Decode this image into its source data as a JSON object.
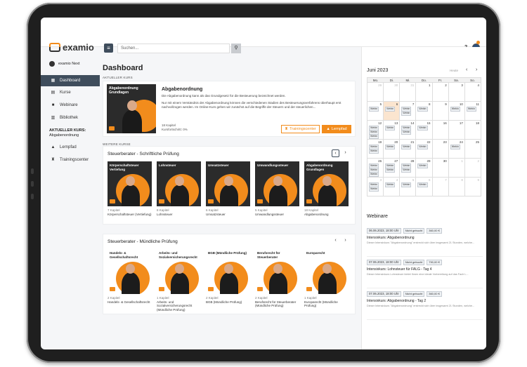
{
  "app": {
    "logo_text": "examio",
    "search_placeholder": "Suchen...",
    "help": "?"
  },
  "sidebar": {
    "user": "examio Next",
    "items": [
      {
        "label": "Dashboard",
        "icon": "dashboard-icon",
        "active": true
      },
      {
        "label": "Kurse",
        "icon": "courses-icon"
      },
      {
        "label": "Webinare",
        "icon": "webinar-icon"
      },
      {
        "label": "Bibliothek",
        "icon": "library-icon"
      }
    ],
    "current_course_label": "AKTUELLER KURS:",
    "current_course": "Abgabenordnung",
    "sub_items": [
      {
        "label": "Lernpfad",
        "icon": "graduation-cap-icon"
      },
      {
        "label": "Trainingscenter",
        "icon": "trophy-icon"
      }
    ]
  },
  "main": {
    "title": "Dashboard",
    "current_label": "AKTUELLER KURS",
    "hero": {
      "image_title": "Abgabenordnung Grundlagen",
      "title": "Abgabenordnung",
      "text1": "Die Abgabenordnung kann als das Grundgesetz für die Besteuerung bezeichnet werden.",
      "text2": "Nur mit einem Verständnis der Abgabenordnung können die verschiedenen Stadien des Besteuerungsverfahrens überhaupt erst nachvollzogen werden. Im Online-Kurs gehen wir zunächst auf die Begriffe der Steuern und der steuerlichen...",
      "chapters": "18 Kapitel",
      "progress": "Kursfortschritt: 0%",
      "btn_training": "Trainingscenter",
      "btn_path": "Lernpfad"
    },
    "more_label": "WEITERE KURSE",
    "row1": {
      "title": "Steuerberater - Schriftliche Prüfung",
      "tiles": [
        {
          "img": "Körperschaftsteuer Vertiefung",
          "chapters": "7 Kapitel",
          "name": "Körperschaftsteuer (Vertiefung)"
        },
        {
          "img": "Lohnsteuer",
          "chapters": "8 Kapitel",
          "name": "Lohnsteuer"
        },
        {
          "img": "Umsatzsteuer",
          "chapters": "6 Kapitel",
          "name": "Umsatzsteuer"
        },
        {
          "img": "Umwandlungssteuer",
          "chapters": "5 Kapitel",
          "name": "Umwandlungssteuer"
        },
        {
          "img": "Abgabenordnung Grundlagen",
          "chapters": "18 Kapitel",
          "name": "Abgabenordnung"
        }
      ]
    },
    "row2": {
      "title": "Steuerberater - Mündliche Prüfung",
      "tiles": [
        {
          "img": "Handels- & Gesellschaftsrecht",
          "chapters": "2 Kapitel",
          "name": "Handels- & Gesellschaftsrecht"
        },
        {
          "img": "Arbeits- und Sozialversicherungsrecht",
          "chapters": "1 Kapitel",
          "name": "Arbeits- und Sozialversicherungsrecht (Mündliche Prüfung)"
        },
        {
          "img": "BGB (Mündliche Prüfung)",
          "chapters": "2 Kapitel",
          "name": "BGB (Mündliche Prüfung)"
        },
        {
          "img": "Berufsrecht für Steuerberater",
          "chapters": "2 Kapitel",
          "name": "Berufsrecht für Steuerberater (Mündliche Prüfung)"
        },
        {
          "img": "Europarecht",
          "chapters": "1 Kapitel",
          "name": "Europarecht (Mündliche Prüfung)"
        }
      ]
    }
  },
  "calendar": {
    "title": "Juni 2023",
    "today": "Heute",
    "days": [
      "Mo.",
      "Di.",
      "Mi.",
      "Do.",
      "Fr.",
      "Sa.",
      "So."
    ],
    "weeks": [
      [
        {
          "n": "29",
          "o": 1
        },
        {
          "n": "30",
          "o": 1
        },
        {
          "n": "31",
          "o": 1
        },
        {
          "n": "1"
        },
        {
          "n": "2"
        },
        {
          "n": "3"
        },
        {
          "n": "4"
        }
      ],
      [
        {
          "n": "5",
          "e": [
            "Webin"
          ]
        },
        {
          "n": "6",
          "t": 1,
          "e": [
            "Webin"
          ]
        },
        {
          "n": "7",
          "e": [
            "Webin",
            "Webin"
          ]
        },
        {
          "n": "8",
          "e": [
            "Webin"
          ]
        },
        {
          "n": "9"
        },
        {
          "n": "10",
          "e": [
            "Webin"
          ]
        },
        {
          "n": "11",
          "e": [
            "Webin"
          ]
        }
      ],
      [
        {
          "n": "12",
          "e": [
            "Webin",
            "Webin",
            "Webin"
          ]
        },
        {
          "n": "13",
          "e": [
            "Webin"
          ]
        },
        {
          "n": "14",
          "e": [
            "Webin",
            "Webin"
          ]
        },
        {
          "n": "15",
          "e": [
            "Webin"
          ]
        },
        {
          "n": "16"
        },
        {
          "n": "17"
        },
        {
          "n": "18"
        }
      ],
      [
        {
          "n": "19",
          "e": [
            "Webin",
            "Webin"
          ]
        },
        {
          "n": "20",
          "e": [
            "Webin"
          ]
        },
        {
          "n": "21",
          "e": [
            "Webin"
          ]
        },
        {
          "n": "22",
          "e": [
            "Webin"
          ]
        },
        {
          "n": "23"
        },
        {
          "n": "24",
          "e": [
            "Webin"
          ]
        },
        {
          "n": "25"
        }
      ],
      [
        {
          "n": "26",
          "e": [
            "Webin",
            "Webin",
            "Webin"
          ]
        },
        {
          "n": "27",
          "e": [
            "Webin",
            "Webin"
          ]
        },
        {
          "n": "28",
          "e": [
            "Webin",
            "Webin"
          ]
        },
        {
          "n": "29",
          "e": [
            "Webin"
          ]
        },
        {
          "n": "30"
        },
        {
          "n": "1",
          "o": 1
        },
        {
          "n": "2",
          "o": 1
        }
      ],
      [
        {
          "n": "3",
          "o": 1,
          "e": [
            "Webin",
            "Webin"
          ]
        },
        {
          "n": "4",
          "o": 1,
          "e": [
            "Webin"
          ]
        },
        {
          "n": "5",
          "o": 1,
          "e": [
            "Webin"
          ]
        },
        {
          "n": "6",
          "o": 1,
          "e": [
            "Webin"
          ]
        },
        {
          "n": "7",
          "o": 1
        },
        {
          "n": "8",
          "o": 1
        },
        {
          "n": "9",
          "o": 1
        }
      ]
    ]
  },
  "webinars": {
    "title": "Webinare",
    "items": [
      {
        "date": "06.06.2023, 18:00 Uhr",
        "badge1": "Nicht gebucht",
        "badge2": "360,00 €",
        "name": "Intensivkurs: Abgabenordnung",
        "desc": "Dieser Intensivkurs \"Abgabenordnung\" erstreckt sich über insgesamt 21 Stunden, welche..."
      },
      {
        "date": "07.06.2023, 18:00 Uhr",
        "badge1": "Nicht gebucht",
        "badge2": "790,00 €",
        "name": "Intensivkurs: Lohnsteuer für FALG - Tag 4",
        "desc": "Dieser Intensivkurs Lohnsteuer bietet Ihnen eine ideale Vorbereitung auf das Fach L..."
      },
      {
        "date": "07.06.2023, 18:00 Uhr",
        "badge1": "Nicht gebucht",
        "badge2": "360,00 €",
        "name": "Intensivkurs: Abgabenordnung - Tag 2",
        "desc": "Dieser Intensivkurs \"Abgabenordnung\" erstreckt sich über insgesamt 21 Stunden, welche..."
      }
    ]
  }
}
